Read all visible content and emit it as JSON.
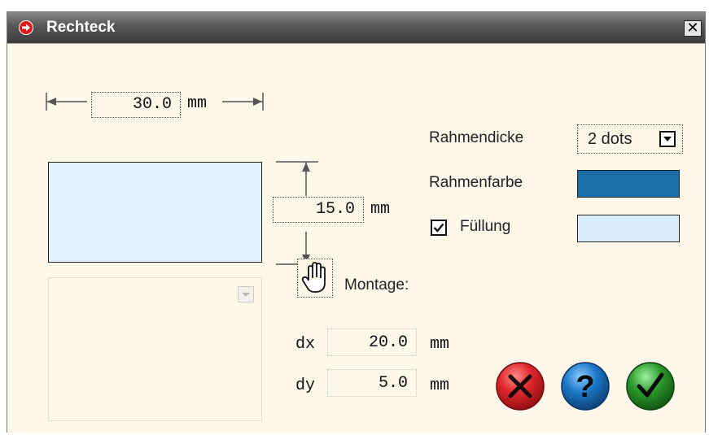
{
  "window": {
    "title": "Rechteck",
    "close_glyph": "✕"
  },
  "dimensions": {
    "width_value": "30.0",
    "width_unit": "mm",
    "height_value": "15.0",
    "height_unit": "mm"
  },
  "properties": {
    "frame_thickness_label": "Rahmendicke",
    "frame_thickness_value": "2 dots",
    "frame_color_label": "Rahmenfarbe",
    "frame_color": "#1a6fa6",
    "fill_label": "Füllung",
    "fill_checked": true,
    "fill_color": "#d9ecf9"
  },
  "montage": {
    "label": "Montage:",
    "dx_label": "dx",
    "dx_value": "20.0",
    "dx_unit": "mm",
    "dy_label": "dy",
    "dy_value": "5.0",
    "dy_unit": "mm"
  },
  "icons": {
    "title": "red-arrow-icon",
    "hand": "hand-icon",
    "cancel": "cancel-x-icon",
    "help": "help-question-icon",
    "ok": "ok-check-icon"
  },
  "colors": {
    "cancel": "#d8262a",
    "help": "#1d78c8",
    "ok": "#2c9a2c"
  }
}
